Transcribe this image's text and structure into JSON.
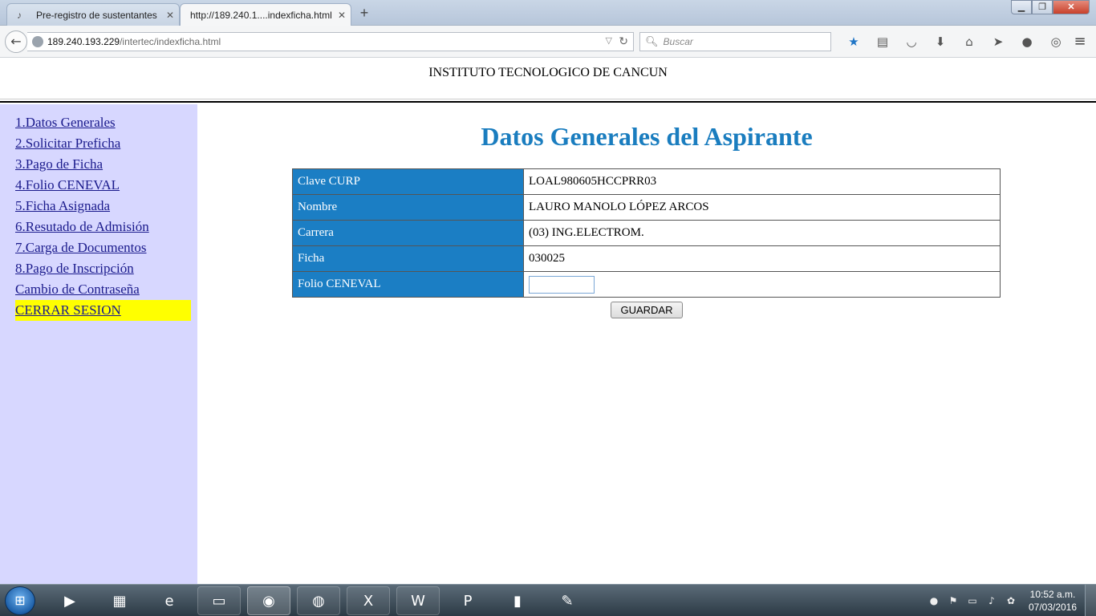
{
  "browser": {
    "tabs": [
      {
        "title": "Pre-registro de sustentantes",
        "close": "✕"
      },
      {
        "title": "http://189.240.1....indexficha.html",
        "close": "✕"
      }
    ],
    "new_tab": "+",
    "url_host": "189.240.193.229",
    "url_path": "/intertec/indexficha.html",
    "search_placeholder": "Buscar",
    "window_controls": {
      "minimize": "▁",
      "maximize": "❐",
      "close": "✕"
    }
  },
  "page": {
    "institution": "INSTITUTO TECNOLOGICO DE CANCUN",
    "title": "Datos Generales del Aspirante",
    "sidebar": [
      {
        "label": "1.Datos Generales"
      },
      {
        "label": "2.Solicitar Preficha"
      },
      {
        "label": "3.Pago de Ficha"
      },
      {
        "label": "4.Folio CENEVAL"
      },
      {
        "label": "5.Ficha Asignada"
      },
      {
        "label": "6.Resutado de Admisión"
      },
      {
        "label": "7.Carga de Documentos"
      },
      {
        "label": "8.Pago de Inscripción"
      },
      {
        "label": "Cambio de Contraseña"
      },
      {
        "label": "CERRAR SESION"
      }
    ],
    "rows": [
      {
        "label": "Clave CURP",
        "value": "LOAL980605HCCPRR03"
      },
      {
        "label": "Nombre",
        "value": "LAURO MANOLO LÓPEZ ARCOS"
      },
      {
        "label": "Carrera",
        "value": "(03) ING.ELECTROM."
      },
      {
        "label": "Ficha",
        "value": "030025"
      },
      {
        "label": "Folio CENEVAL",
        "value": ""
      }
    ],
    "save_label": "GUARDAR"
  },
  "taskbar": {
    "time": "10:52 a.m.",
    "date": "07/03/2016"
  },
  "colors": {
    "sidebar_bg": "#d7d7ff",
    "title_color": "#1a7dbf",
    "label_cell_bg": "#1b7ec4",
    "logout_highlight": "#ffff00"
  }
}
